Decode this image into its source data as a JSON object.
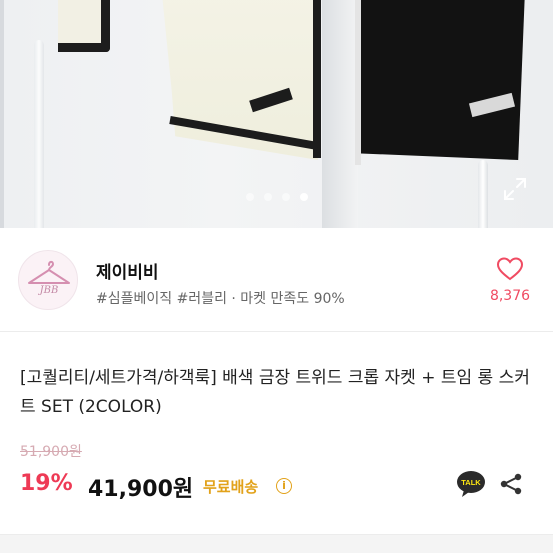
{
  "gallery": {
    "slide_count": 4,
    "active_slide": 4
  },
  "shop": {
    "logo_text": "JBB",
    "name": "제이비비",
    "tags": "#심플베이직 #러블리 · 마켓 만족도 90%",
    "like_count": "8,376"
  },
  "product": {
    "title": "[고퀄리티/세트가격/하객룩] 배색 금장 트위드 크롭 자켓 + 트임 롱 스커트 SET (2COLOR)",
    "original_price": "51,900원",
    "discount": "19%",
    "price": "41,900원",
    "shipping_label": "무료배송",
    "info_symbol": "i",
    "talk_label": "TALK"
  },
  "colors": {
    "accent": "#ee3a55",
    "like": "#f04b62",
    "shipping": "#e2a21a",
    "original_price": "#d6aab2",
    "logo": "#c48aa6"
  },
  "icons": [
    "expand-icon",
    "heart-icon",
    "kakao-talk-icon",
    "share-icon",
    "info-icon",
    "hanger-icon"
  ]
}
